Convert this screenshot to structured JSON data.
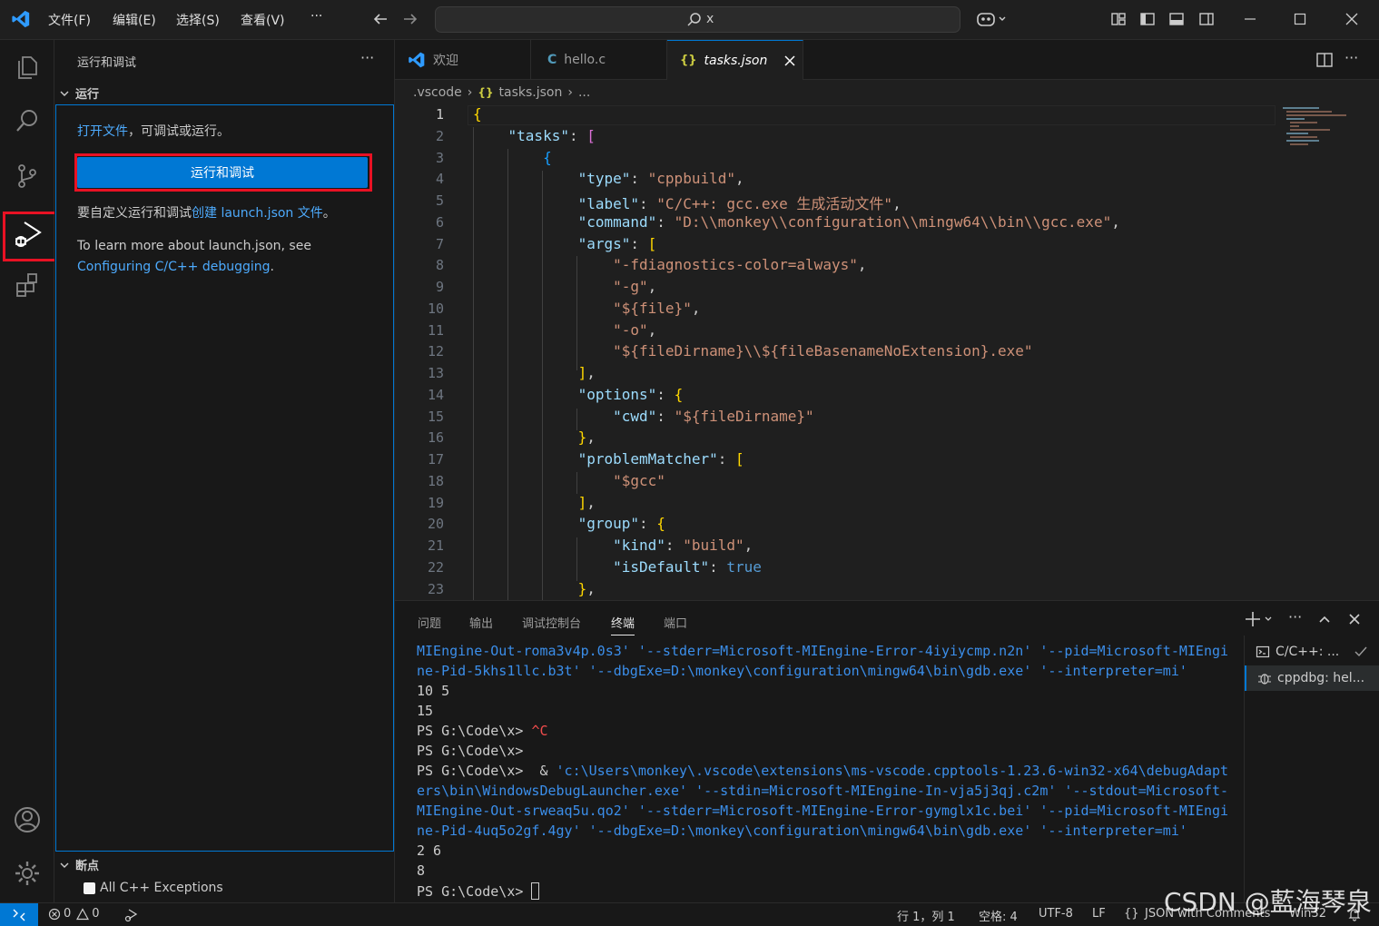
{
  "menu": [
    "文件(F)",
    "编辑(E)",
    "选择(S)",
    "查看(V)",
    "···"
  ],
  "command_center": {
    "text": "x"
  },
  "sidebar": {
    "title": "运行和调试",
    "more": "···",
    "run_section": "运行",
    "open_file_link": "打开文件",
    "open_file_suffix": "，可调试或运行。",
    "run_button": "运行和调试",
    "customize_prefix": "要自定义运行和调试",
    "customize_link": "创建 launch.json 文件",
    "customize_suffix": "。",
    "learn_more": "To learn more about launch.json, see",
    "learn_link": "Configuring C/C++ debugging",
    "learn_suffix": ".",
    "breakpoints_section": "断点",
    "breakpoint_item": "All C++ Exceptions"
  },
  "tabs": [
    {
      "label": "欢迎"
    },
    {
      "label": "hello.c"
    },
    {
      "label": "tasks.json"
    }
  ],
  "breadcrumb": [
    ".vscode",
    "tasks.json",
    "..."
  ],
  "line_numbers": [
    "1",
    "2",
    "3",
    "4",
    "5",
    "6",
    "7",
    "8",
    "9",
    "10",
    "11",
    "12",
    "13",
    "14",
    "15",
    "16",
    "17",
    "18",
    "19",
    "20",
    "21",
    "22",
    "23"
  ],
  "panel": {
    "tabs": [
      "问题",
      "输出",
      "调试控制台",
      "终端",
      "端口"
    ],
    "terminal_lines": [
      "MIEngine-Out-roma3v4p.0s3' '--stderr=Microsoft-MIEngine-Error-4iyiycmp.n2n' '--pid=Microsoft-MIEngi",
      "ne-Pid-5khs1llc.b3t' '--dbgExe=D:\\monkey\\configuration\\mingw64\\bin\\gdb.exe' '--interpreter=mi'",
      "10 5",
      "15",
      "PS G:\\Code\\x> ",
      "PS G:\\Code\\x>",
      "PS G:\\Code\\x>  & ",
      "ers\\bin\\WindowsDebugLauncher.exe' '--stdin=Microsoft-MIEngine-In-vja5j3qj.c2m' '--stdout=Microsoft-",
      "MIEngine-Out-srweaq5u.qo2' '--stderr=Microsoft-MIEngine-Error-gymglx1c.bei' '--pid=Microsoft-MIEngi",
      "ne-Pid-4uq5o2gf.4gy' '--dbgExe=D:\\monkey\\configuration\\mingw64\\bin\\gdb.exe' '--interpreter=mi'",
      "2 6",
      "8",
      "PS G:\\Code\\x> "
    ],
    "ctrl_c": "^C",
    "launcher_path": "'c:\\Users\\monkey\\.vscode\\extensions\\ms-vscode.cpptools-1.23.6-win32-x64\\debugAdapt",
    "terminals": [
      "C/C++: ...",
      "cppdbg: hel..."
    ]
  },
  "status": {
    "errors": "0",
    "warnings": "0",
    "position": "行 1，列 1",
    "spaces": "空格: 4",
    "encoding": "UTF-8",
    "eol": "LF",
    "language": "JSON with Comments",
    "platform": "Win32"
  },
  "watermark": "CSDN @藍海琴泉",
  "colors": {
    "accent": "#0078d4",
    "highlight": "#e81123"
  }
}
